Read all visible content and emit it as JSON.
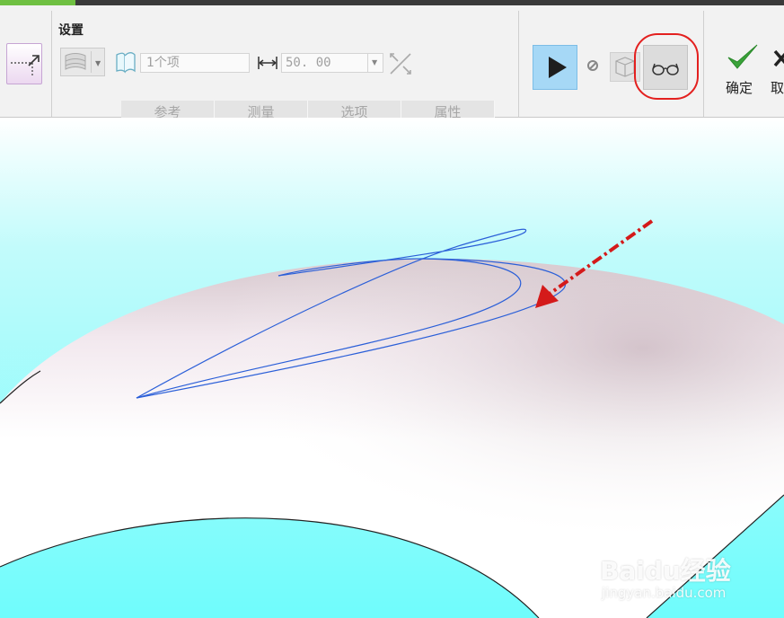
{
  "ribbon": {
    "group_title": "设置",
    "reference_field": {
      "value": "1个项"
    },
    "value_field": {
      "value": "50. 00"
    },
    "tabs": [
      {
        "label": "参考"
      },
      {
        "label": "测量"
      },
      {
        "label": "选项"
      },
      {
        "label": "属性"
      }
    ],
    "ok_label": "确定",
    "cancel_label": "取"
  },
  "watermark": {
    "brand": "Baidu经验",
    "url": "jingyan.baidu.com"
  },
  "colors": {
    "accent_green": "#6fc042",
    "play_bg": "#a6d8f6",
    "highlight_red": "#e3201f",
    "viewport_cyan": "#6ffcfc",
    "curve_blue": "#2b5fd8"
  },
  "icons": {
    "surface": "surface-icon",
    "sweep": "sweep-icon",
    "length": "length-icon",
    "flip": "flip-icon",
    "play": "play-icon",
    "pause": "pause-icon",
    "preview": "preview-icon",
    "glasses": "glasses-icon",
    "ok": "checkmark-icon",
    "cancel": "close-icon"
  }
}
